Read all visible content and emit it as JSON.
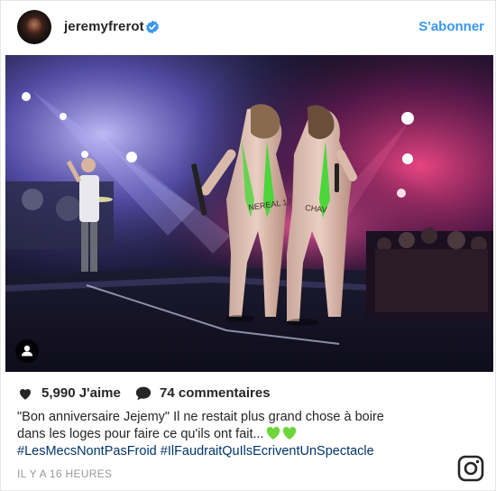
{
  "header": {
    "username": "jeremyfrerot",
    "follow_label": "S'abonner"
  },
  "photo": {
    "alt_icons": [
      "person-tag-icon"
    ],
    "body_text_left": "NEREAL 17",
    "body_text_right": "CHAV"
  },
  "actions": {
    "likes_label": "5,990 J'aime",
    "comments_label": "74 commentaires"
  },
  "caption": {
    "line1": "\"Bon anniversaire Jejemy\" Il ne restait plus grand chose à boire",
    "line2": "dans les loges pour faire ce qu'ils ont fait...",
    "hashtags": "#LesMecsNontPasFroid #IlFaudraitQuIlsEcriventUnSpectacle"
  },
  "timestamp": "IL Y A 16 HEURES",
  "colors": {
    "accent": "#3897f0",
    "hashtag": "#003569",
    "heart_emoji": "#6fd63a"
  }
}
